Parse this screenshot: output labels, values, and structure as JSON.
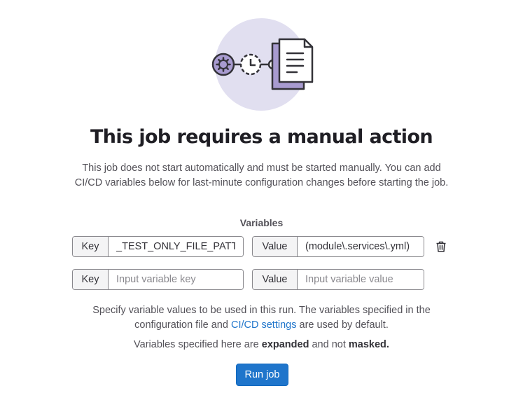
{
  "empty_state": {
    "title": "This job requires a manual action",
    "description": "This job does not start automatically and must be started manually. You can add CI/CD variables below for last-minute configuration changes before starting the job."
  },
  "variables": {
    "heading": "Variables",
    "key_addon": "Key",
    "value_addon": "Value",
    "key_placeholder": "Input variable key",
    "value_placeholder": "Input variable value",
    "rows": [
      {
        "key": "_TEST_ONLY_FILE_PATTERN",
        "value": "(module\\.services\\.yml)"
      }
    ]
  },
  "help": {
    "text_before": "Specify variable values to be used in this run. The variables specified in the configuration file and",
    "link": "CI/CD settings",
    "text_after": "are used by default."
  },
  "note": {
    "prefix": "Variables specified here are",
    "bold1": "expanded",
    "middle": "and not",
    "bold2": "masked."
  },
  "actions": {
    "run_label": "Run job"
  },
  "colors": {
    "accent": "#1f75cb",
    "illustration_circle": "#e1dff0",
    "illustration_purple": "#a89bd0"
  },
  "icons": [
    "gear-icon",
    "clock-icon",
    "document-icon",
    "trash-icon"
  ]
}
